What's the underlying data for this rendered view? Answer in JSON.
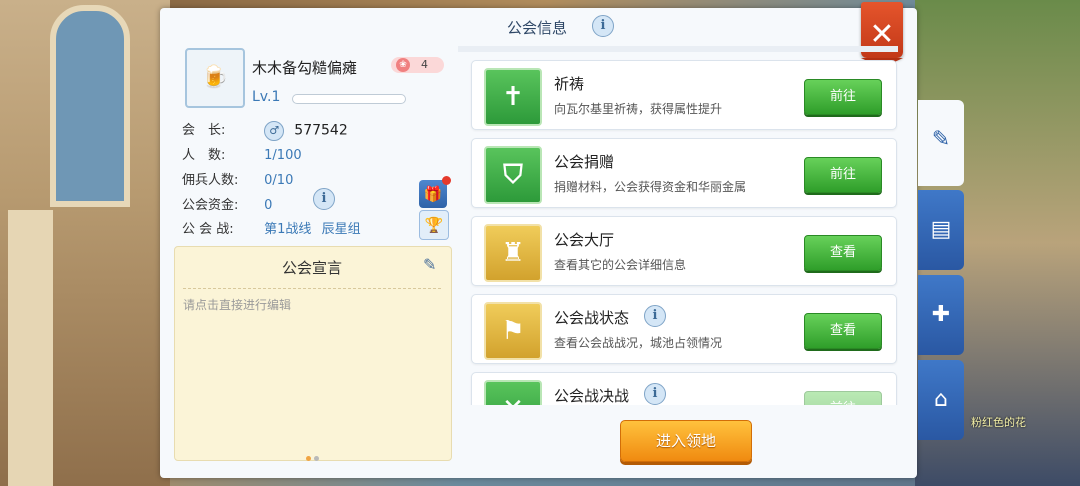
{
  "header": {
    "title": "公会信息"
  },
  "guild": {
    "name": "木木备勾糙偏瘫",
    "count": "4",
    "level": "Lv.1",
    "rows": {
      "leader_label": "会　长:",
      "leader_value": "577542",
      "people_label": "人　数:",
      "people_value": "1/100",
      "merc_label": "佣兵人数:",
      "merc_value": "0/10",
      "funds_label": "公会资金:",
      "funds_value": "0",
      "war_label": "公 会 战:",
      "war_line": "第1战线",
      "war_group": "辰星组"
    }
  },
  "manifesto": {
    "title": "公会宣言",
    "placeholder": "请点击直接进行编辑"
  },
  "list": {
    "items": [
      {
        "title": "祈祷",
        "desc": "向瓦尔基里祈祷，获得属性提升",
        "button": "前往"
      },
      {
        "title": "公会捐赠",
        "desc": "捐赠材料，公会获得资金和华丽金属",
        "button": "前往"
      },
      {
        "title": "公会大厅",
        "desc": "查看其它的公会详细信息",
        "button": "查看"
      },
      {
        "title": "公会战状态",
        "desc": "查看公会战战况，城池占领情况",
        "button": "查看"
      },
      {
        "title": "公会战决战",
        "desc": "",
        "button": "前往"
      }
    ]
  },
  "bottom": {
    "enter_button": "进入领地"
  },
  "scene": {
    "flower_label": "粉红色的花"
  },
  "colors": {
    "accent_blue": "#2f63a8",
    "go_green": "#3fae36",
    "enter_orange": "#f6a21f",
    "close_red": "#d9441f"
  }
}
